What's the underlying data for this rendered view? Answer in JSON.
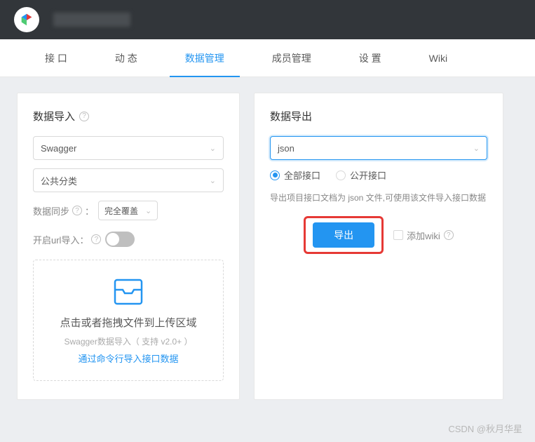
{
  "tabs": {
    "items": [
      {
        "label": "接 口"
      },
      {
        "label": "动 态"
      },
      {
        "label": "数据管理"
      },
      {
        "label": "成员管理"
      },
      {
        "label": "设 置"
      },
      {
        "label": "Wiki"
      }
    ]
  },
  "import": {
    "title": "数据导入",
    "format_selected": "Swagger",
    "category_selected": "公共分类",
    "sync_label": "数据同步",
    "sync_selected": "完全覆盖",
    "url_import_label": "开启url导入：",
    "upload": {
      "title": "点击或者拖拽文件到上传区域",
      "subtitle": "Swagger数据导入（ 支持 v2.0+ ）",
      "link": "通过命令行导入接口数据"
    }
  },
  "export": {
    "title": "数据导出",
    "format_selected": "json",
    "radio_all": "全部接口",
    "radio_public": "公开接口",
    "hint": "导出项目接口文档为 json 文件,可使用该文件导入接口数据",
    "button": "导出",
    "wiki_checkbox": "添加wiki"
  },
  "watermark": "CSDN @秋月华星"
}
